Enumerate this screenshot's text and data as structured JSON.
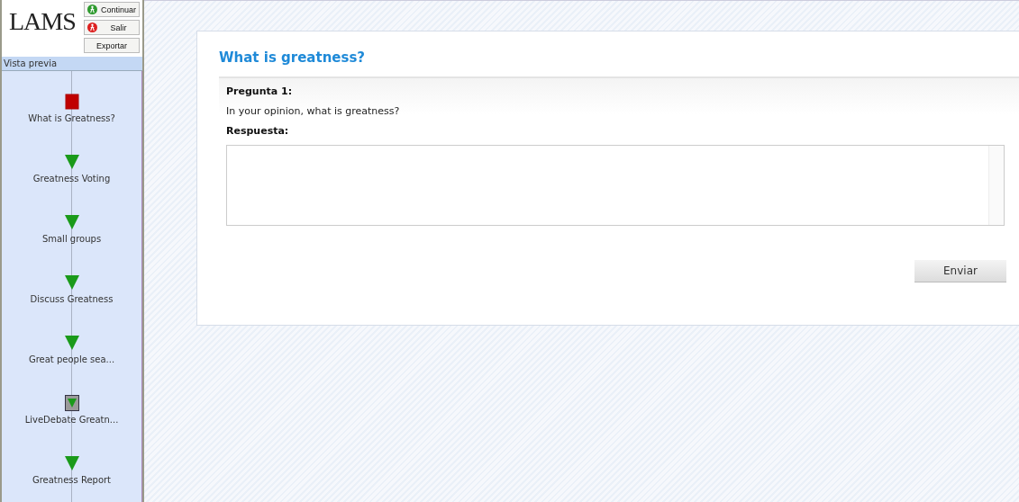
{
  "logo": "LAMS",
  "controls": [
    {
      "label": "Continuar",
      "kind": "go"
    },
    {
      "label": "Salir",
      "kind": "stop"
    },
    {
      "label": "Exportar",
      "kind": "plain"
    }
  ],
  "sidebar": {
    "title": "Vista previa",
    "activities": [
      {
        "label": "What is Greatness?",
        "kind": "current"
      },
      {
        "label": "Greatness Voting",
        "kind": "todo"
      },
      {
        "label": "Small groups",
        "kind": "todo"
      },
      {
        "label": "Discuss Greatness",
        "kind": "todo"
      },
      {
        "label": "Great people sea...",
        "kind": "todo"
      },
      {
        "label": "LiveDebate Greatn...",
        "kind": "gate"
      },
      {
        "label": "Greatness Report",
        "kind": "todo"
      }
    ]
  },
  "content": {
    "title": "What is greatness?",
    "question_label": "Pregunta 1:",
    "question": "In your opinion, what is greatness?",
    "answer_label": "Respuesta:",
    "submit": "Enviar"
  }
}
